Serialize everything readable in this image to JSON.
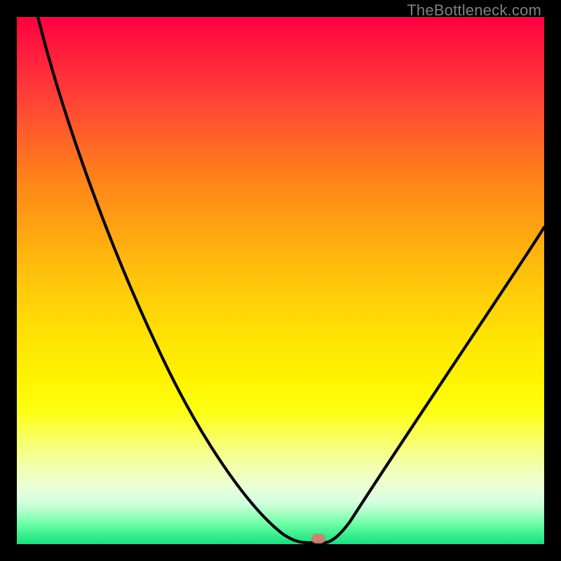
{
  "watermark": "TheBottleneck.com",
  "colors": {
    "curve": "#000000",
    "marker": "#cc7f70",
    "frame": "#000000"
  },
  "chart_data": {
    "type": "line",
    "title": "",
    "xlabel": "",
    "ylabel": "",
    "xlim": [
      0,
      100
    ],
    "ylim": [
      0,
      100
    ],
    "grid": false,
    "legend": null,
    "series": [
      {
        "name": "bottleneck-curve",
        "x": [
          4,
          10,
          16,
          22,
          28,
          34,
          40,
          46,
          50,
          53,
          55,
          57,
          60,
          64,
          68,
          72,
          78,
          84,
          90,
          96,
          100
        ],
        "y": [
          100,
          88,
          76,
          64,
          52,
          40,
          28,
          16,
          8,
          3,
          1,
          1,
          1,
          5,
          12,
          20,
          30,
          40,
          48,
          55,
          60
        ]
      }
    ],
    "marker": {
      "x": 57,
      "y": 1
    },
    "annotations": []
  }
}
